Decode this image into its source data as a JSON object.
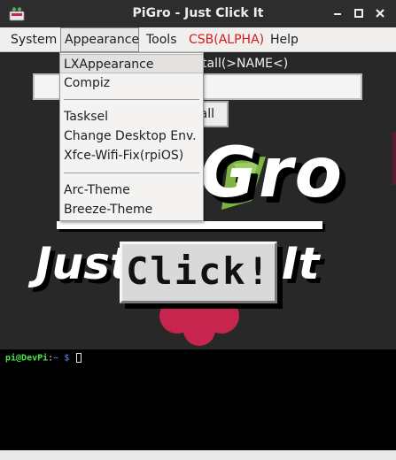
{
  "window": {
    "title": "PiGro - Just Click It",
    "icon": "raspberry-pi-app-icon",
    "controls": [
      "minimize-icon",
      "maximize-icon",
      "close-icon"
    ]
  },
  "menubar": {
    "items": [
      {
        "label": "System"
      },
      {
        "label": "Appearance"
      },
      {
        "label": "Tools"
      },
      {
        "label": "CSB(ALPHA)",
        "color": "#d31b1b"
      },
      {
        "label": "Help"
      }
    ]
  },
  "dropdown": {
    "items": [
      {
        "label": "LXAppearance"
      },
      {
        "label": "Compiz"
      },
      {
        "label": "Tasksel"
      },
      {
        "label": "Change Desktop Env."
      },
      {
        "label": "Xfce-Wifi-Fix(rpiOS)"
      },
      {
        "label": "Arc-Theme"
      },
      {
        "label": "Breeze-Theme"
      }
    ]
  },
  "main": {
    "install_label": "tall(>NAME<)",
    "name_input_value": "",
    "install_button": "all",
    "logo": {
      "gro_text": "Gro",
      "just_text": "Just",
      "click_text": "Click!",
      "it_text": "It"
    }
  },
  "terminal": {
    "user": "pi@DevPi",
    "colon": ":",
    "path": "~",
    "prompt": " $ "
  },
  "colors": {
    "accent_red": "#c7254e",
    "menu_bg": "#f0efee",
    "terminal_bg": "#000000"
  }
}
